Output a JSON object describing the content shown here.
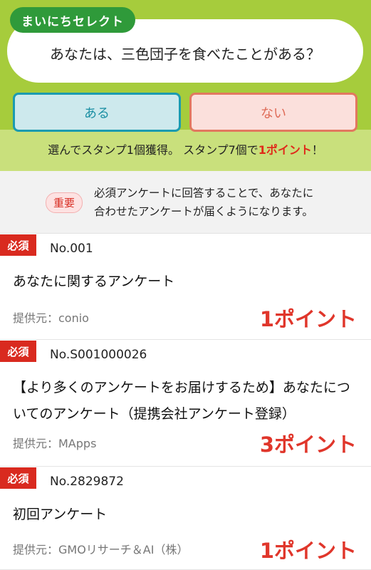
{
  "daily_select": {
    "tag": "まいにちセレクト",
    "question": "あなたは、三色団子を食べたことがある？",
    "yes_label": "ある",
    "no_label": "ない",
    "stamp_note_prefix": "選んでスタンプ1個獲得。 スタンプ7個で",
    "stamp_note_points": "1ポイント",
    "stamp_note_suffix": "！"
  },
  "notice": {
    "badge": "重要",
    "line1": "必須アンケートに回答することで、あなたに",
    "line2": "合わせたアンケートが届くようになります。"
  },
  "surveys": [
    {
      "badge": "必須",
      "number": "No.001",
      "title": "あなたに関するアンケート",
      "provider": "提供元：conio",
      "points": "1ポイント"
    },
    {
      "badge": "必須",
      "number": "No.S001000026",
      "title": "【より多くのアンケートをお届けするため】あなたについてのアンケート（提携会社アンケート登録）",
      "provider": "提供元：MApps",
      "points": "3ポイント"
    },
    {
      "badge": "必須",
      "number": "No.2829872",
      "title": "初回アンケート",
      "provider": "提供元：GMOリサーチ＆AI（株）",
      "points": "1ポイント"
    }
  ],
  "colors": {
    "header_green": "#a6cc3c",
    "tag_green": "#2f9a3a",
    "required_red": "#d92a1f",
    "points_red": "#e0362b"
  }
}
